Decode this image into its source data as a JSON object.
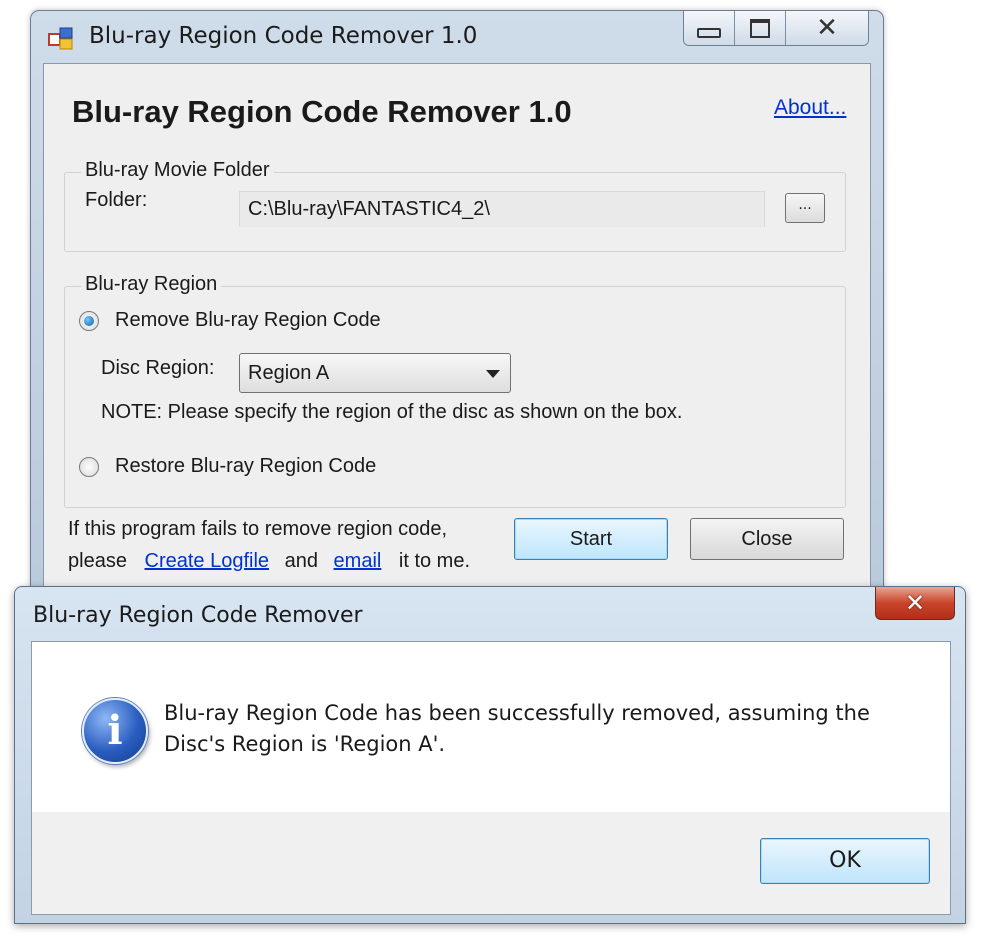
{
  "main_window": {
    "title": "Blu-ray Region Code Remover 1.0",
    "heading": "Blu-ray Region Code Remover 1.0",
    "about_link": "About...",
    "folder_group": {
      "legend": "Blu-ray Movie Folder",
      "folder_label": "Folder:",
      "folder_value": "C:\\Blu-ray\\FANTASTIC4_2\\",
      "browse_label": "..."
    },
    "region_group": {
      "legend": "Blu-ray Region",
      "remove_option": "Remove Blu-ray Region Code",
      "disc_region_label": "Disc Region:",
      "disc_region_value": "Region A",
      "note": "NOTE: Please specify the region of the disc as shown on the box.",
      "restore_option": "Restore Blu-ray Region Code",
      "selected_option": "remove"
    },
    "footer": {
      "line1": "If this program fails to remove region code,",
      "please": "please",
      "create_logfile": "Create Logfile",
      "and": "and",
      "email": "email",
      "tail": "it to me."
    },
    "start_label": "Start",
    "close_label": "Close"
  },
  "message_box": {
    "title": "Blu-ray Region Code Remover",
    "message_line1": "Blu-ray Region Code has been successfully removed, assuming the",
    "message_line2": "Disc's Region is 'Region A'.",
    "ok_label": "OK",
    "icon": "info-icon"
  }
}
